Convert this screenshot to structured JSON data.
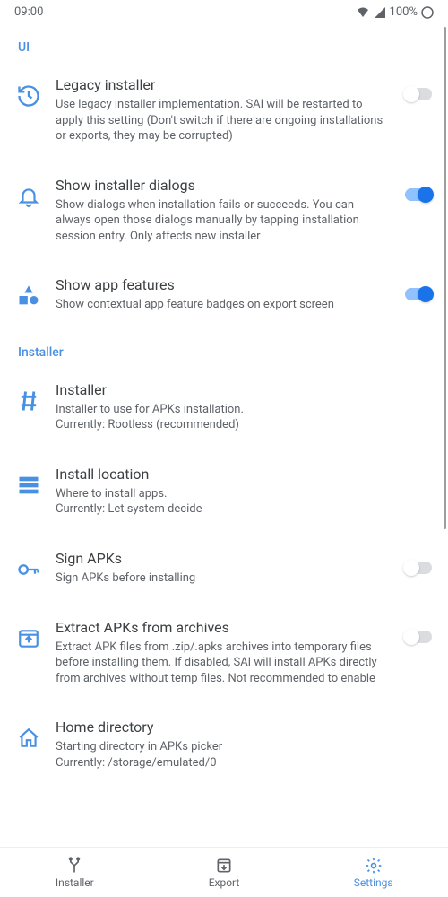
{
  "statusbar": {
    "time": "09:00",
    "battery": "100%"
  },
  "sections": {
    "ui": {
      "header": "UI",
      "legacy_installer": {
        "title": "Legacy installer",
        "desc": "Use legacy installer implementation. SAI will be restarted to apply this setting (Don't switch if there are ongoing installations or exports, they may be corrupted)"
      },
      "show_dialogs": {
        "title": "Show installer dialogs",
        "desc": "Show dialogs when installation fails or succeeds. You can always open those dialogs manually by tapping installation session entry. Only affects new installer"
      },
      "show_features": {
        "title": "Show app features",
        "desc": "Show contextual app feature badges on export screen"
      }
    },
    "installer": {
      "header": "Installer",
      "installer_choice": {
        "title": "Installer",
        "desc": "Installer to use for APKs installation.\nCurrently: Rootless (recommended)"
      },
      "install_location": {
        "title": "Install location",
        "desc": "Where to install apps.\nCurrently: Let system decide"
      },
      "sign_apks": {
        "title": "Sign APKs",
        "desc": "Sign APKs before installing"
      },
      "extract_apks": {
        "title": "Extract APKs from archives",
        "desc": "Extract APK files from .zip/.apks archives into temporary files before installing them. If disabled, SAI will install APKs directly from archives without temp files. Not recommended to enable"
      },
      "home_directory": {
        "title": "Home directory",
        "desc": "Starting directory in APKs picker\nCurrently: /storage/emulated/0"
      }
    }
  },
  "nav": {
    "installer": "Installer",
    "export": "Export",
    "settings": "Settings"
  }
}
